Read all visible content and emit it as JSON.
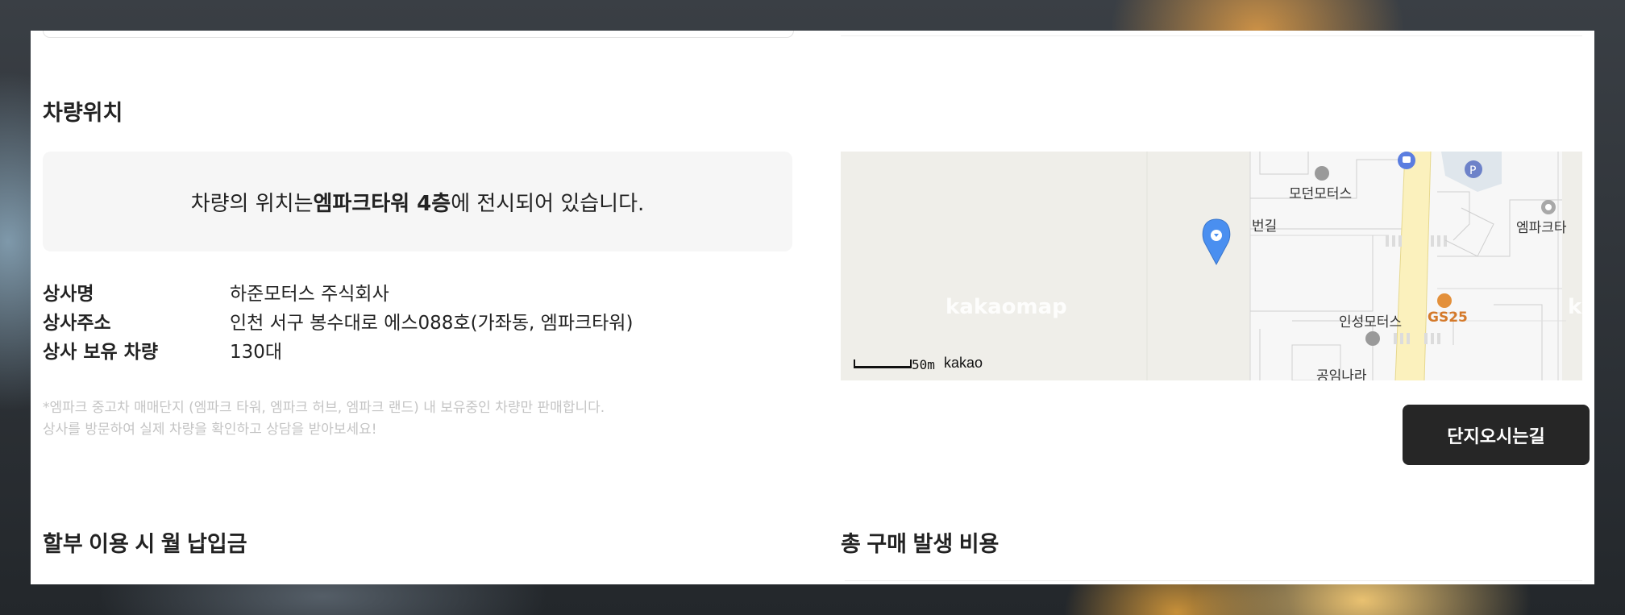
{
  "location": {
    "section_title": "차량위치",
    "notice_prefix": "차량의 위치는 ",
    "notice_bold": "엠파크타워 4층",
    "notice_suffix": "에 전시되어 있습니다.",
    "dealer_name_label": "상사명",
    "dealer_name_value": "하준모터스 주식회사",
    "dealer_address_label": "상사주소",
    "dealer_address_value": "인천 서구 봉수대로 에스088호(가좌동, 엠파크타워)",
    "dealer_cars_label": "상사 보유 차량",
    "dealer_cars_value": "130대",
    "note_line1": "*엠파크 중고차 매매단지 (엠파크 타워, 엠파크 허브, 엠파크 랜드) 내 보유중인 차량만 판매합니다.",
    "note_line2": "상사를 방문하여 실제 차량을 확인하고 상담을 받아보세요!"
  },
  "map": {
    "labels": {
      "modern_motors": "모던모터스",
      "road": "번길",
      "empark": "엠파크타",
      "insung_motors": "인성모터스",
      "gs25": "GS25",
      "gongim": "공임나라"
    },
    "watermark": "kakaomap",
    "watermark_partial": "kal",
    "scale": "50m",
    "brand": "kakao",
    "pin_color": "#4a8ff0"
  },
  "directions_button": "단지오시는길",
  "sections": {
    "installment_title": "할부 이용 시 월 납입금",
    "total_cost_title": "총 구매 발생 비용"
  }
}
